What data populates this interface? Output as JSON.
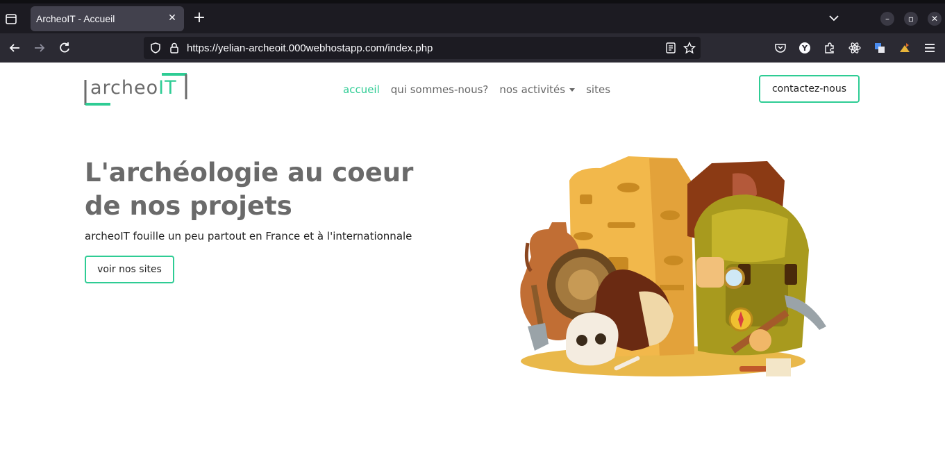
{
  "browser": {
    "tab_title": "ArcheoIT - Accueil",
    "url": "https://yelian-archeoit.000webhostapp.com/index.php"
  },
  "site": {
    "logo_main": "archeo",
    "logo_accent": "IT",
    "nav": [
      {
        "label": "accueil"
      },
      {
        "label": "qui sommes-nous?"
      },
      {
        "label": "nos activités"
      },
      {
        "label": "sites"
      }
    ],
    "contact_label": "contactez-nous"
  },
  "hero": {
    "title": "L'archéologie au coeur de nos projets",
    "subtitle": "archeoIT fouille un peu partout en France et à l'internationnale",
    "cta_label": "voir nos sites"
  },
  "colors": {
    "accent": "#2ecc94",
    "chrome_dark": "#1c1b22"
  }
}
